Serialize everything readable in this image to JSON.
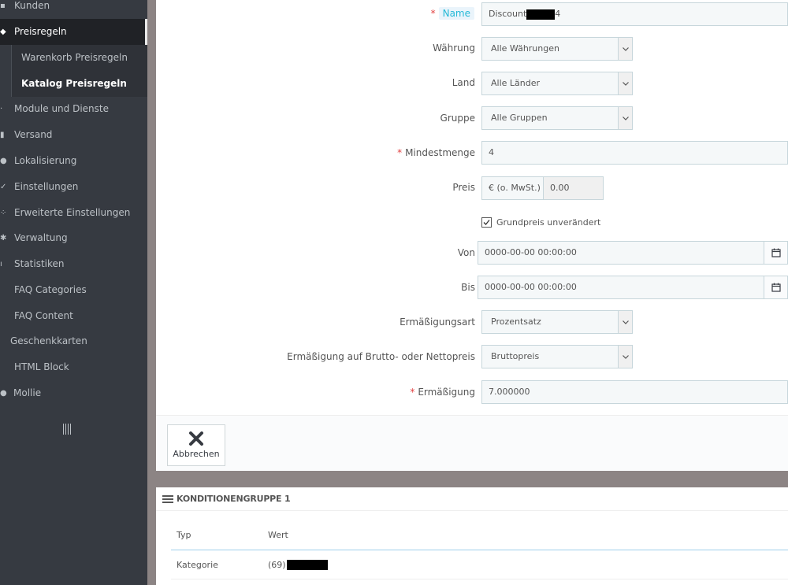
{
  "sidebar": {
    "items": [
      {
        "label": "Kunden",
        "icon": "user-icon"
      },
      {
        "label": "Preisregeln",
        "icon": "tag-icon",
        "active": true
      },
      {
        "label": "Module und Dienste",
        "icon": "puzzle-icon"
      },
      {
        "label": "Versand",
        "icon": "truck-icon"
      },
      {
        "label": "Lokalisierung",
        "icon": "globe-icon"
      },
      {
        "label": "Einstellungen",
        "icon": "wrench-icon"
      },
      {
        "label": "Erweiterte Einstellungen",
        "icon": "cogs-icon"
      },
      {
        "label": "Verwaltung",
        "icon": "gear-icon"
      },
      {
        "label": "Statistiken",
        "icon": "bar-chart-icon"
      },
      {
        "label": "FAQ Categories",
        "icon": ""
      },
      {
        "label": "FAQ Content",
        "icon": ""
      },
      {
        "label": "Geschenkkarten",
        "icon": ""
      },
      {
        "label": "HTML Block",
        "icon": ""
      },
      {
        "label": "Mollie",
        "icon": "mollie-icon"
      }
    ],
    "subitems": [
      {
        "label": "Warenkorb Preisregeln"
      },
      {
        "label": "Katalog Preisregeln",
        "current": true
      }
    ]
  },
  "form": {
    "name": {
      "label": "Name",
      "value_prefix": "Discount",
      "value_suffix": "4"
    },
    "waehrung": {
      "label": "Währung",
      "value": "Alle Währungen"
    },
    "land": {
      "label": "Land",
      "value": "Alle Länder"
    },
    "gruppe": {
      "label": "Gruppe",
      "value": "Alle Gruppen"
    },
    "mindestmenge": {
      "label": "Mindestmenge",
      "value": "4"
    },
    "preis": {
      "label": "Preis",
      "addon": "€ (o. MwSt.)",
      "value": "0.00"
    },
    "grundpreis": {
      "label": "Grundpreis unverändert",
      "checked": true
    },
    "von": {
      "label": "Von",
      "value": "0000-00-00 00:00:00"
    },
    "bis": {
      "label": "Bis",
      "value": "0000-00-00 00:00:00"
    },
    "ermaessigungsart": {
      "label": "Ermäßigungsart",
      "value": "Prozentsatz"
    },
    "brutto_netto": {
      "label": "Ermäßigung auf Brutto- oder Nettopreis",
      "value": "Bruttopreis"
    },
    "ermaessigung": {
      "label": "Ermäßigung",
      "value": "7.000000"
    },
    "required_marker": "*",
    "cancel_label": "Abbrechen"
  },
  "conditions": {
    "title": "KONDITIONENGRUPPE 1",
    "columns": [
      "Typ",
      "Wert"
    ],
    "rows": [
      {
        "typ": "Kategorie",
        "wert_prefix": "(69)"
      }
    ]
  },
  "colors": {
    "sidebar_bg": "#363a41",
    "sidebar_active_bg": "#202226",
    "required": "#e24040",
    "accent": "#25b9d7"
  }
}
